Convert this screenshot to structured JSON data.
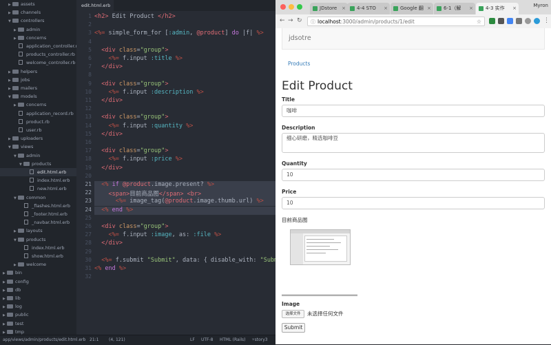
{
  "editor": {
    "tree": [
      {
        "label": "assets",
        "kind": "folder",
        "depth": 1,
        "open": false
      },
      {
        "label": "channels",
        "kind": "folder",
        "depth": 1,
        "open": false
      },
      {
        "label": "controllers",
        "kind": "folder",
        "depth": 1,
        "open": true
      },
      {
        "label": "admin",
        "kind": "folder",
        "depth": 2,
        "open": false
      },
      {
        "label": "concerns",
        "kind": "folder",
        "depth": 2,
        "open": false
      },
      {
        "label": "application_controller.rb",
        "kind": "file",
        "depth": 2
      },
      {
        "label": "products_controller.rb",
        "kind": "file",
        "depth": 2
      },
      {
        "label": "welcome_controller.rb",
        "kind": "file",
        "depth": 2
      },
      {
        "label": "helpers",
        "kind": "folder",
        "depth": 1,
        "open": false
      },
      {
        "label": "jobs",
        "kind": "folder",
        "depth": 1,
        "open": false
      },
      {
        "label": "mailers",
        "kind": "folder",
        "depth": 1,
        "open": false
      },
      {
        "label": "models",
        "kind": "folder",
        "depth": 1,
        "open": true
      },
      {
        "label": "concerns",
        "kind": "folder",
        "depth": 2,
        "open": false
      },
      {
        "label": "application_record.rb",
        "kind": "file",
        "depth": 2
      },
      {
        "label": "product.rb",
        "kind": "file",
        "depth": 2
      },
      {
        "label": "user.rb",
        "kind": "file",
        "depth": 2
      },
      {
        "label": "uploaders",
        "kind": "folder",
        "depth": 1,
        "open": false
      },
      {
        "label": "views",
        "kind": "folder",
        "depth": 1,
        "open": true
      },
      {
        "label": "admin",
        "kind": "folder",
        "depth": 2,
        "open": true
      },
      {
        "label": "products",
        "kind": "folder",
        "depth": 3,
        "open": true
      },
      {
        "label": "edit.html.erb",
        "kind": "file",
        "depth": 4,
        "selected": true
      },
      {
        "label": "index.html.erb",
        "kind": "file",
        "depth": 4
      },
      {
        "label": "new.html.erb",
        "kind": "file",
        "depth": 4
      },
      {
        "label": "common",
        "kind": "folder",
        "depth": 2,
        "open": true
      },
      {
        "label": "_flashes.html.erb",
        "kind": "file",
        "depth": 3
      },
      {
        "label": "_footer.html.erb",
        "kind": "file",
        "depth": 3
      },
      {
        "label": "_navbar.html.erb",
        "kind": "file",
        "depth": 3
      },
      {
        "label": "layouts",
        "kind": "folder",
        "depth": 2,
        "open": false
      },
      {
        "label": "products",
        "kind": "folder",
        "depth": 2,
        "open": true
      },
      {
        "label": "index.html.erb",
        "kind": "file",
        "depth": 3
      },
      {
        "label": "show.html.erb",
        "kind": "file",
        "depth": 3
      },
      {
        "label": "welcome",
        "kind": "folder",
        "depth": 2,
        "open": false
      },
      {
        "label": "bin",
        "kind": "folder",
        "depth": 0,
        "open": false
      },
      {
        "label": "config",
        "kind": "folder",
        "depth": 0,
        "open": false
      },
      {
        "label": "db",
        "kind": "folder",
        "depth": 0,
        "open": false
      },
      {
        "label": "lib",
        "kind": "folder",
        "depth": 0,
        "open": false
      },
      {
        "label": "log",
        "kind": "folder",
        "depth": 0,
        "open": false
      },
      {
        "label": "public",
        "kind": "folder",
        "depth": 0,
        "open": false
      },
      {
        "label": "test",
        "kind": "folder",
        "depth": 0,
        "open": false
      },
      {
        "label": "tmp",
        "kind": "folder",
        "depth": 0,
        "open": false
      }
    ],
    "active_tab": "edit.html.erb",
    "highlighted_lines": [
      21,
      22,
      23,
      24
    ],
    "code": [
      [
        [
          "tag",
          "<h2>"
        ],
        [
          "txt",
          " Edit Product "
        ],
        [
          "tag",
          "</h2>"
        ]
      ],
      [],
      [
        [
          "erb",
          "<%="
        ],
        [
          "txt",
          " simple_form_for ["
        ],
        [
          "sym",
          ":admin"
        ],
        [
          "txt",
          ", "
        ],
        [
          "ivar",
          "@product"
        ],
        [
          "txt",
          "] "
        ],
        [
          "kw",
          "do"
        ],
        [
          "txt",
          " |f| "
        ],
        [
          "erb",
          "%>"
        ]
      ],
      [],
      [
        [
          "txt",
          "  "
        ],
        [
          "tag",
          "<div "
        ],
        [
          "attr",
          "class"
        ],
        [
          "txt",
          "="
        ],
        [
          "str",
          "\"group\""
        ],
        [
          "tag",
          ">"
        ]
      ],
      [
        [
          "txt",
          "    "
        ],
        [
          "erb",
          "<%="
        ],
        [
          "txt",
          " f.input "
        ],
        [
          "sym",
          ":title"
        ],
        [
          "txt",
          " "
        ],
        [
          "erb",
          "%>"
        ]
      ],
      [
        [
          "txt",
          "  "
        ],
        [
          "tag",
          "</div>"
        ]
      ],
      [],
      [
        [
          "txt",
          "  "
        ],
        [
          "tag",
          "<div "
        ],
        [
          "attr",
          "class"
        ],
        [
          "txt",
          "="
        ],
        [
          "str",
          "\"group\""
        ],
        [
          "tag",
          ">"
        ]
      ],
      [
        [
          "txt",
          "    "
        ],
        [
          "erb",
          "<%="
        ],
        [
          "txt",
          " f.input "
        ],
        [
          "sym",
          ":description"
        ],
        [
          "txt",
          " "
        ],
        [
          "erb",
          "%>"
        ]
      ],
      [
        [
          "txt",
          "  "
        ],
        [
          "tag",
          "</div>"
        ]
      ],
      [],
      [
        [
          "txt",
          "  "
        ],
        [
          "tag",
          "<div "
        ],
        [
          "attr",
          "class"
        ],
        [
          "txt",
          "="
        ],
        [
          "str",
          "\"group\""
        ],
        [
          "tag",
          ">"
        ]
      ],
      [
        [
          "txt",
          "    "
        ],
        [
          "erb",
          "<%="
        ],
        [
          "txt",
          " f.input "
        ],
        [
          "sym",
          ":quantity"
        ],
        [
          "txt",
          " "
        ],
        [
          "erb",
          "%>"
        ]
      ],
      [
        [
          "txt",
          "  "
        ],
        [
          "tag",
          "</div>"
        ]
      ],
      [],
      [
        [
          "txt",
          "  "
        ],
        [
          "tag",
          "<div "
        ],
        [
          "attr",
          "class"
        ],
        [
          "txt",
          "="
        ],
        [
          "str",
          "\"group\""
        ],
        [
          "tag",
          ">"
        ]
      ],
      [
        [
          "txt",
          "    "
        ],
        [
          "erb",
          "<%="
        ],
        [
          "txt",
          " f.input "
        ],
        [
          "sym",
          ":price"
        ],
        [
          "txt",
          " "
        ],
        [
          "erb",
          "%>"
        ]
      ],
      [
        [
          "txt",
          "  "
        ],
        [
          "tag",
          "</div>"
        ]
      ],
      [],
      [
        [
          "txt",
          "  "
        ],
        [
          "erb",
          "<%"
        ],
        [
          "txt",
          " "
        ],
        [
          "kw",
          "if"
        ],
        [
          "txt",
          " "
        ],
        [
          "ivar",
          "@product"
        ],
        [
          "txt",
          ".image.present? "
        ],
        [
          "erb",
          "%>"
        ]
      ],
      [
        [
          "txt",
          "    "
        ],
        [
          "tag",
          "<span>"
        ],
        [
          "txt",
          "目前商品图"
        ],
        [
          "tag",
          "</span>"
        ],
        [
          "txt",
          " "
        ],
        [
          "tag",
          "<br>"
        ]
      ],
      [
        [
          "txt",
          "      "
        ],
        [
          "erb",
          "<%="
        ],
        [
          "txt",
          " image_tag("
        ],
        [
          "ivar",
          "@product"
        ],
        [
          "txt",
          ".image.thumb.url) "
        ],
        [
          "erb",
          "%>"
        ]
      ],
      [
        [
          "txt",
          "  "
        ],
        [
          "erb",
          "<%"
        ],
        [
          "txt",
          " "
        ],
        [
          "kw",
          "end"
        ],
        [
          "txt",
          " "
        ],
        [
          "erb",
          "%>"
        ]
      ],
      [],
      [
        [
          "txt",
          "  "
        ],
        [
          "tag",
          "<div "
        ],
        [
          "attr",
          "class"
        ],
        [
          "txt",
          "="
        ],
        [
          "str",
          "\"group\""
        ],
        [
          "tag",
          ">"
        ]
      ],
      [
        [
          "txt",
          "    "
        ],
        [
          "erb",
          "<%="
        ],
        [
          "txt",
          " f.input "
        ],
        [
          "sym",
          ":image"
        ],
        [
          "txt",
          ", as: "
        ],
        [
          "sym",
          ":file"
        ],
        [
          "txt",
          " "
        ],
        [
          "erb",
          "%>"
        ]
      ],
      [
        [
          "txt",
          "  "
        ],
        [
          "tag",
          "</div>"
        ]
      ],
      [],
      [
        [
          "txt",
          "  "
        ],
        [
          "erb",
          "<%="
        ],
        [
          "txt",
          " f.submit "
        ],
        [
          "str",
          "\"Submit\""
        ],
        [
          "txt",
          ", data: { disable_with: "
        ],
        [
          "str",
          "\"Submitting...\""
        ],
        [
          "txt",
          " } "
        ],
        [
          "erb",
          "%>"
        ]
      ],
      [
        [
          "erb",
          "<%"
        ],
        [
          "txt",
          " "
        ],
        [
          "kw",
          "end"
        ],
        [
          "txt",
          " "
        ],
        [
          "erb",
          "%>"
        ]
      ],
      []
    ],
    "status": {
      "path": "app/views/admin/products/edit.html.erb",
      "cursor": "21:1",
      "selection": "(4, 121)",
      "line_ending": "LF",
      "encoding": "UTF-8",
      "grammar": "HTML (Rails)",
      "branch": "story3"
    }
  },
  "browser": {
    "tabs": [
      {
        "title": "JDstore",
        "active": false
      },
      {
        "title": "4-4 STO",
        "active": false
      },
      {
        "title": "Google 翻",
        "active": false
      },
      {
        "title": "6-1（解",
        "active": false
      },
      {
        "title": "4-3 实作",
        "active": true
      }
    ],
    "profile": "Myron",
    "url_host": "localhost",
    "url_rest": ":3000/admin/products/1/edit",
    "page": {
      "brand": "jdsotre",
      "breadcrumb": "Products",
      "heading": "Edit Product",
      "fields": [
        {
          "label": "Title",
          "value": "咖啡",
          "tall": false
        },
        {
          "label": "Description",
          "value": "细心研磨，精选咖啡豆",
          "tall": true
        },
        {
          "label": "Quantity",
          "value": "10",
          "tall": false
        },
        {
          "label": "Price",
          "value": "10",
          "tall": false
        }
      ],
      "image_caption": "目前商品图",
      "image_label": "Image",
      "choose_file": "选择文件",
      "no_file": "未选择任何文件",
      "submit": "Submit"
    }
  },
  "colors": {
    "tree_bg": "#21252b",
    "editor_bg": "#282c34",
    "link": "#337ab7",
    "favicon": "#3aa35b"
  }
}
